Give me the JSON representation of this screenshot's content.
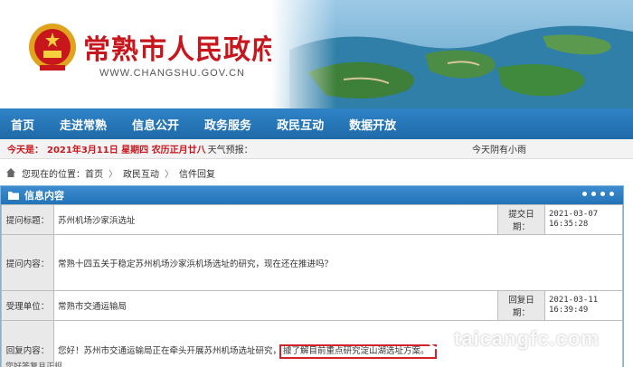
{
  "header": {
    "site_title": "常熟市人民政府",
    "site_url": "WWW.CHANGSHU.GOV.CN"
  },
  "nav": {
    "items": [
      "首页",
      "走进常熟",
      "信息公开",
      "政务服务",
      "政民互动",
      "数据开放"
    ]
  },
  "today": {
    "label": "今天是：",
    "date": "2021年3月11日 星期四 农历正月廿八",
    "weather_label": "天气预报：",
    "weather": "今天阴有小雨"
  },
  "breadcrumb": {
    "prefix": "您现在的位置：",
    "items": [
      "首页",
      "政民互动",
      "信件回复"
    ]
  },
  "panel": {
    "title": "信息内容",
    "rows": {
      "subject_label": "提问标题：",
      "subject": "苏州机场沙家浜选址",
      "submit_date_label": "提交日期：",
      "submit_date": "2021-03-07",
      "submit_time": "16:35:28",
      "question_label": "提问内容：",
      "question": "常熟十四五关于稳定苏州机场沙家浜机场选址的研究，现在还在推进吗？",
      "unit_label": "受理单位：",
      "unit": "常熟市交通运输局",
      "reply_date_label": "回复日期：",
      "reply_date": "2021-03-11",
      "reply_time": "16:39:49",
      "reply_label": "回复内容：",
      "reply_part1": "您好！苏州市交通运输局正在牵头开展苏州机场选址研究，",
      "reply_highlight": "據了解目前重点研究淀山湖选址方案。"
    }
  },
  "footer": {
    "cut_text": "您好答复且正规"
  },
  "watermark": {
    "text": "taicangfc.com"
  },
  "colors": {
    "nav_blue": "#2273b8",
    "title_red": "#c8161d",
    "highlight_red": "#d2232a"
  }
}
